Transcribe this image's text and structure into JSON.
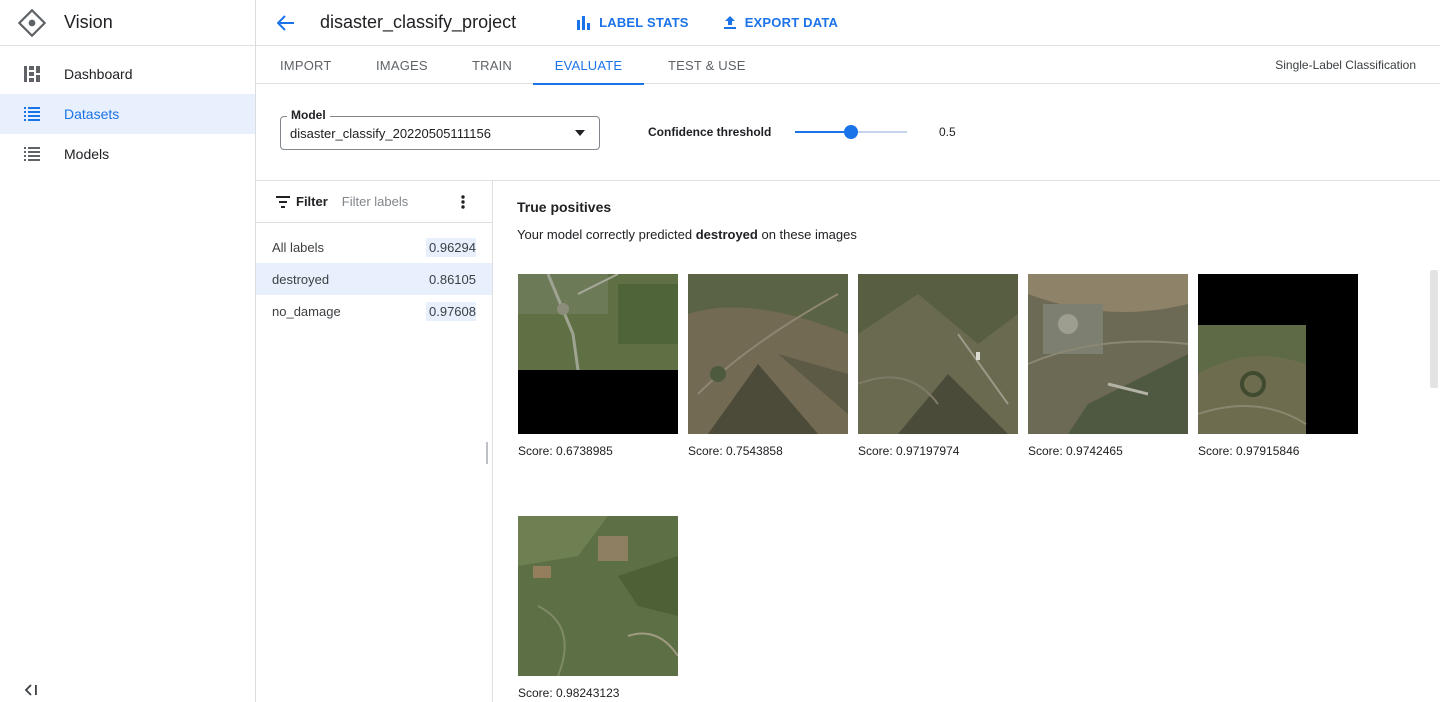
{
  "app": {
    "title": "Vision"
  },
  "sidebar": {
    "items": [
      {
        "label": "Dashboard",
        "icon": "dashboard-icon"
      },
      {
        "label": "Datasets",
        "icon": "list-icon"
      },
      {
        "label": "Models",
        "icon": "list-icon"
      }
    ],
    "active_index": 1
  },
  "header": {
    "project": "disaster_classify_project",
    "label_stats": "LABEL STATS",
    "export_data": "EXPORT DATA"
  },
  "tabs": {
    "items": [
      "IMPORT",
      "IMAGES",
      "TRAIN",
      "EVALUATE",
      "TEST & USE"
    ],
    "active": "EVALUATE",
    "classification_type": "Single-Label Classification"
  },
  "controls": {
    "model_label": "Model",
    "model_value": "disaster_classify_20220505111156",
    "confidence_label": "Confidence threshold",
    "confidence_value": "0.5",
    "confidence_fraction": 0.5
  },
  "labels": {
    "filter_label": "Filter",
    "filter_placeholder": "Filter labels",
    "items": [
      {
        "name": "All labels",
        "score": "0.96294"
      },
      {
        "name": "destroyed",
        "score": "0.86105"
      },
      {
        "name": "no_damage",
        "score": "0.97608"
      }
    ],
    "selected_index": 1
  },
  "results": {
    "title": "True positives",
    "subtitle_prefix": "Your model correctly predicted ",
    "subtitle_label": "destroyed",
    "subtitle_suffix": " on these images",
    "images": [
      {
        "score": "Score: 0.6738985"
      },
      {
        "score": "Score: 0.7543858"
      },
      {
        "score": "Score: 0.97197974"
      },
      {
        "score": "Score: 0.9742465"
      },
      {
        "score": "Score: 0.97915846"
      },
      {
        "score": "Score: 0.98243123"
      }
    ]
  },
  "colors": {
    "accent": "#1a73e8",
    "selected_bg": "#e8f0fe"
  }
}
